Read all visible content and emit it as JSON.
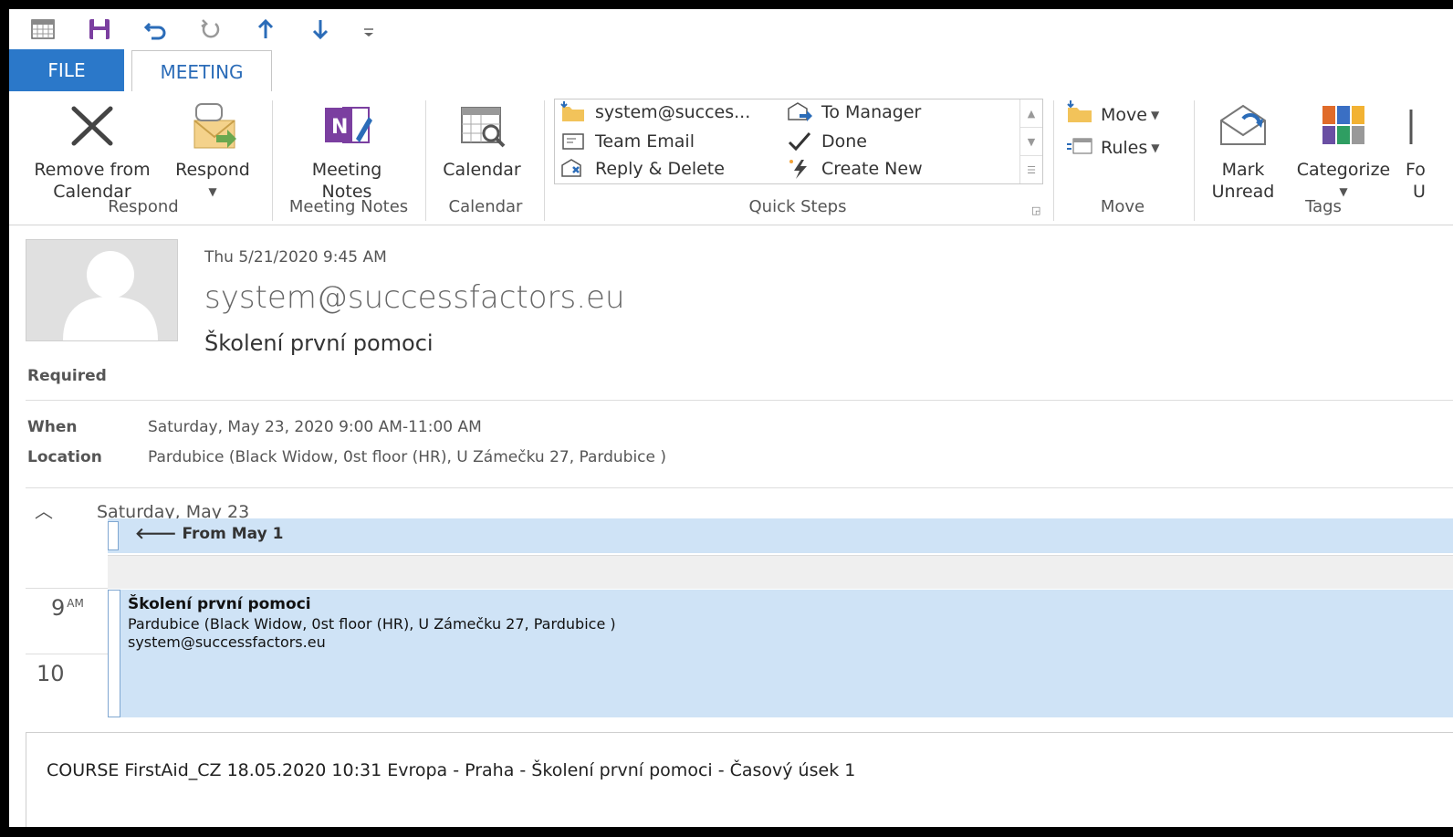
{
  "qat": {
    "icons": [
      "calendar-icon",
      "save-icon",
      "undo-icon",
      "redo-icon",
      "previous-item-icon",
      "next-item-icon",
      "customize-qat-icon"
    ]
  },
  "tabs": [
    {
      "label": "FILE",
      "active": false
    },
    {
      "label": "MEETING",
      "active": true
    }
  ],
  "ribbon": {
    "respond": {
      "group_label": "Respond",
      "remove_line1": "Remove from",
      "remove_line2": "Calendar",
      "respond_label": "Respond"
    },
    "meeting_notes": {
      "group_label": "Meeting Notes",
      "line1": "Meeting",
      "line2": "Notes"
    },
    "calendar": {
      "group_label": "Calendar",
      "label": "Calendar"
    },
    "quick_steps": {
      "group_label": "Quick Steps",
      "items": [
        {
          "label": "system@succes...",
          "icon": "folder-move-icon"
        },
        {
          "label": "To Manager",
          "icon": "forward-envelope-icon"
        },
        {
          "label": "Team Email",
          "icon": "email-icon"
        },
        {
          "label": "Done",
          "icon": "checkmark-icon"
        },
        {
          "label": "Reply & Delete",
          "icon": "reply-delete-icon"
        },
        {
          "label": "Create New",
          "icon": "lightning-icon"
        }
      ]
    },
    "move": {
      "group_label": "Move",
      "move_label": "Move",
      "rules_label": "Rules"
    },
    "tags": {
      "group_label": "Tags",
      "mark_line1": "Mark",
      "mark_line2": "Unread",
      "categorize_label": "Categorize",
      "follow_line1": "Fo",
      "follow_line2": "U"
    }
  },
  "header": {
    "date": "Thu 5/21/2020 9:45 AM",
    "from": "system@successfactors.eu",
    "subject": "Školení první pomoci",
    "required_label": "Required",
    "when_label": "When",
    "when_value": "Saturday, May 23, 2020 9:00 AM-11:00 AM",
    "location_label": "Location",
    "location_value": "Pardubice (Black Widow, 0st floor (HR), U Zámečku 27, Pardubice )"
  },
  "calendar_preview": {
    "day_label": "Saturday, May 23",
    "from_label": "From May 1",
    "time_9": "9",
    "time_9_suffix": "AM",
    "time_10": "10",
    "appointment": {
      "title": "Školení první pomoci",
      "location": "Pardubice (Black Widow, 0st floor (HR), U Zámečku 27, Pardubice )",
      "organizer": "system@successfactors.eu"
    }
  },
  "body": {
    "text": "COURSE FirstAid_CZ 18.05.2020 10:31 Evropa - Praha  -  Školení první pomoci  -  Časový úsek 1"
  },
  "colors": {
    "accent": "#2b78c9",
    "appointment_bg": "#cfe3f6",
    "onenote_purple": "#7b3fa0"
  }
}
